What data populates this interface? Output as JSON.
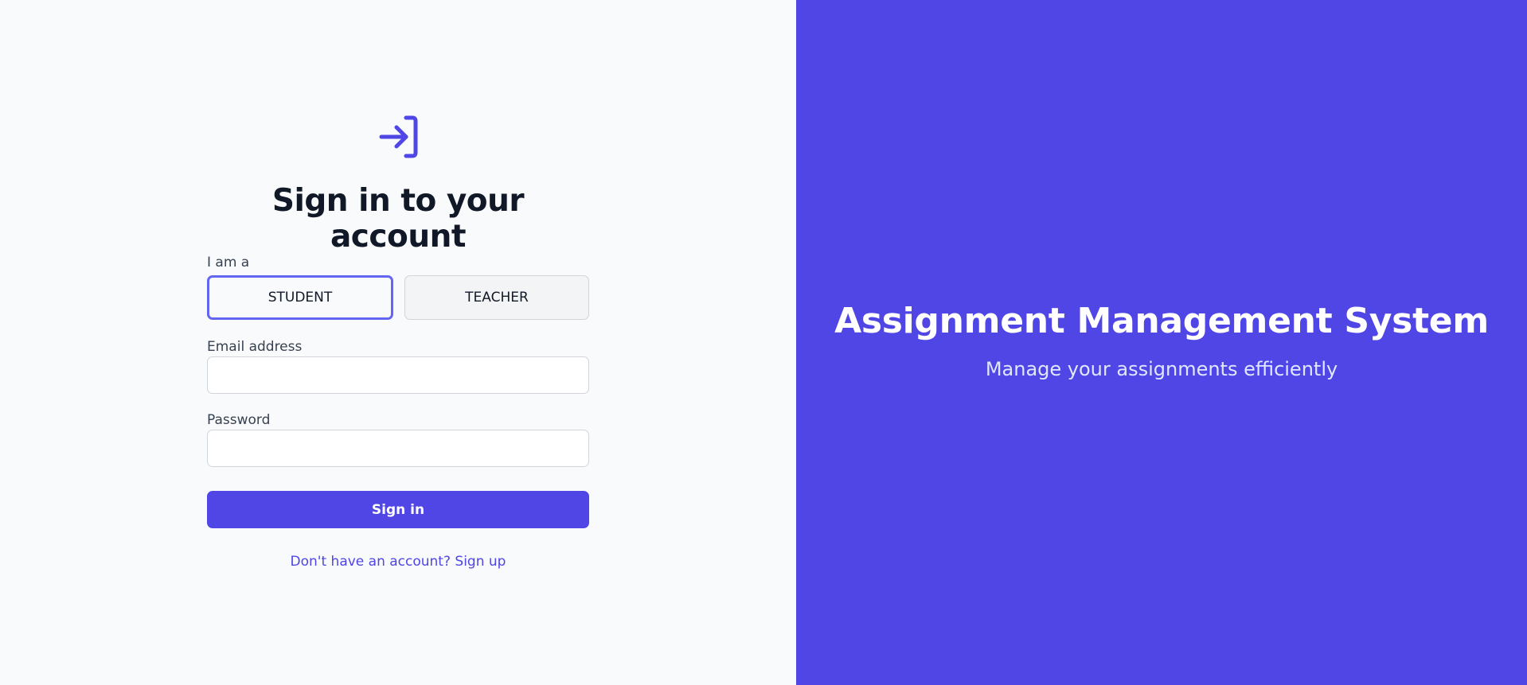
{
  "login": {
    "title": "Sign in to your account",
    "role_label": "I am a",
    "roles": [
      {
        "label": "STUDENT",
        "selected": true
      },
      {
        "label": "TEACHER",
        "selected": false
      }
    ],
    "email": {
      "label": "Email address",
      "value": "",
      "placeholder": ""
    },
    "password": {
      "label": "Password",
      "value": "",
      "placeholder": ""
    },
    "submit_label": "Sign in",
    "signup_link": "Don't have an account? Sign up",
    "icon": "login-arrow-icon"
  },
  "hero": {
    "title": "Assignment Management System",
    "subtitle": "Manage your assignments efficiently"
  },
  "colors": {
    "accent": "#4f46e5",
    "selected_border": "#6366f1",
    "left_bg": "#f9fafb",
    "heading": "#111827"
  }
}
